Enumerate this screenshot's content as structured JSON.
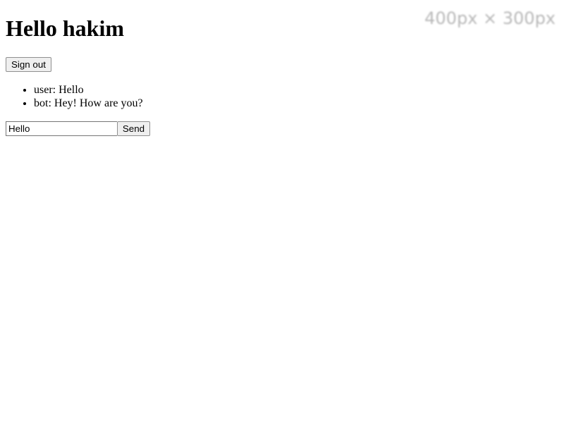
{
  "header": {
    "greeting": "Hello hakim"
  },
  "auth": {
    "sign_out_label": "Sign out"
  },
  "chat": {
    "messages": [
      {
        "text": "user: Hello"
      },
      {
        "text": "bot: Hey! How are you?"
      }
    ]
  },
  "composer": {
    "input_value": "Hello",
    "send_label": "Send"
  },
  "image_placeholder": {
    "label": "400px × 300px"
  }
}
